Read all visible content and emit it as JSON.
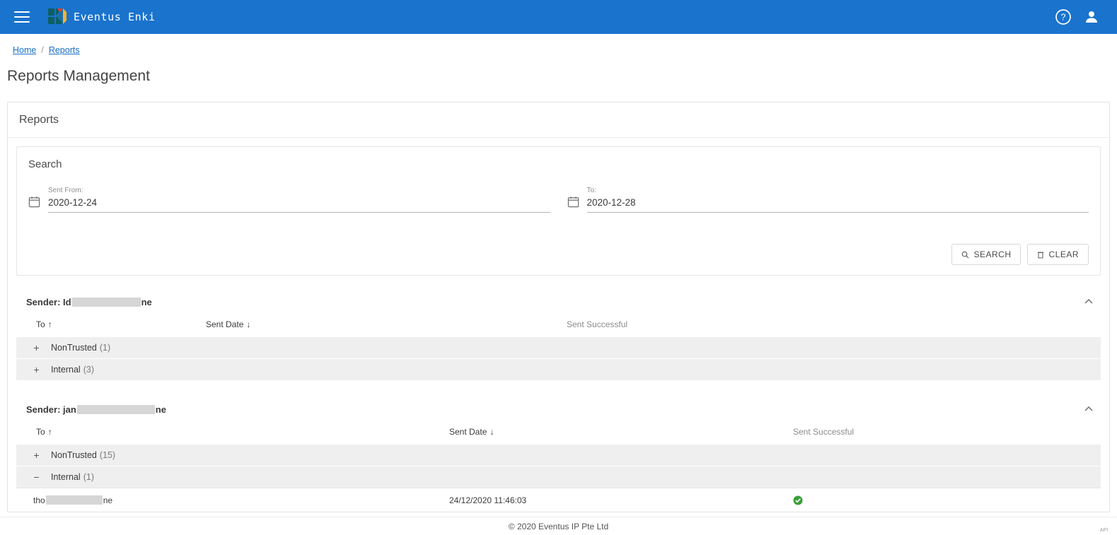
{
  "app": {
    "brand_name": "Eventus Enki",
    "menu_icon": "hamburger-icon",
    "help_icon": "help-circle-icon",
    "account_icon": "account-person-icon",
    "accent_color": "#1a73cd"
  },
  "breadcrumb": {
    "home": "Home",
    "separator": "/",
    "current": "Reports"
  },
  "page": {
    "title": "Reports Management",
    "card_title": "Reports"
  },
  "search": {
    "title": "Search",
    "from_label": "Sent From:",
    "from_value": "2020-12-24",
    "from_placeholder": "yyyy-mm-dd",
    "to_label": "To:",
    "to_value": "2020-12-28",
    "to_placeholder": "yyyy-mm-dd",
    "search_button": "SEARCH",
    "clear_button": "CLEAR",
    "search_icon": "magnifier-icon",
    "clear_icon": "trash-icon",
    "calendar_icon": "calendar-icon"
  },
  "columns": {
    "to": "To",
    "sent_date": "Sent Date",
    "sent_successful": "Sent Successful",
    "sort_asc_glyph": "↑",
    "sort_desc_glyph": "↓"
  },
  "senders": [
    {
      "label_prefix": "Sender: Id",
      "label_suffix": "ne",
      "redacted_width": 97,
      "collapse_icon": "chevron-up-icon",
      "col_x": {
        "to": 40,
        "sent_date": 280,
        "sent_successful": 790
      },
      "groups": [
        {
          "expander": "+",
          "name": "NonTrusted",
          "count": "(1)",
          "expanded": false,
          "rows": []
        },
        {
          "expander": "+",
          "name": "Internal",
          "count": "(3)",
          "expanded": false,
          "rows": []
        }
      ]
    },
    {
      "label_prefix": "Sender: jan",
      "label_suffix": "ne",
      "redacted_width": 110,
      "collapse_icon": "chevron-up-icon",
      "col_x": {
        "to": 40,
        "sent_date": 624,
        "sent_successful": 1110
      },
      "groups": [
        {
          "expander": "+",
          "name": "NonTrusted",
          "count": "(15)",
          "expanded": false,
          "rows": []
        },
        {
          "expander": "−",
          "name": "Internal",
          "count": "(1)",
          "expanded": true,
          "rows": [
            {
              "to_prefix": "tho",
              "to_suffix": "ne",
              "redacted_width": 80,
              "sent_date": "24/12/2020 11:46:03",
              "sent_successful": true,
              "status_icon": "check-circle-icon",
              "status_color": "#3a9e3a"
            }
          ]
        }
      ]
    }
  ],
  "footer": {
    "copyright": "© 2020 Eventus IP Pte Ltd",
    "api_label": "API"
  }
}
